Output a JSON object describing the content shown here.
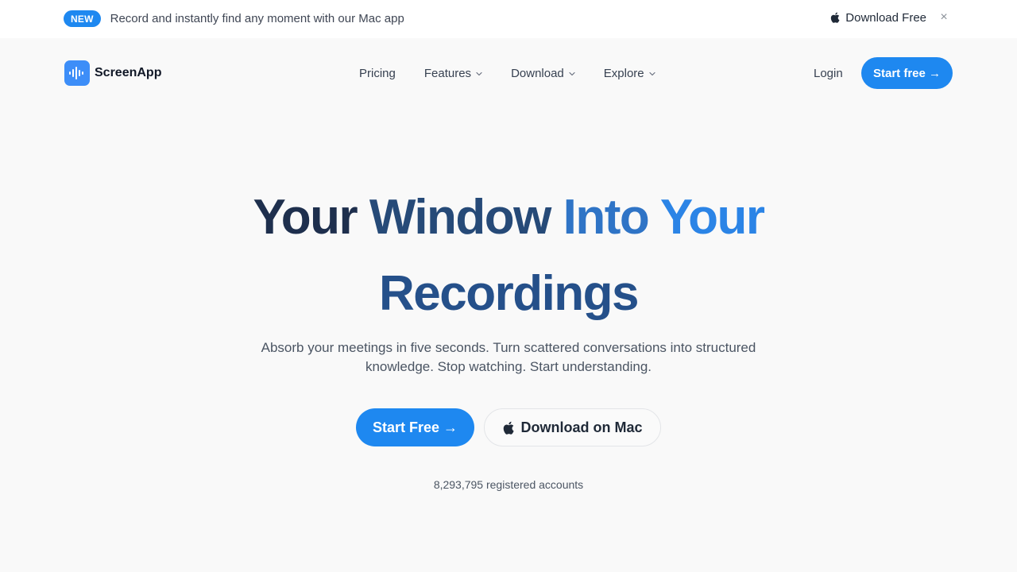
{
  "announcement": {
    "badge": "NEW",
    "text": "Record and instantly find any moment with our Mac app",
    "download_label": "Download Free",
    "close_symbol": "×",
    "apple_icon": "apple-icon"
  },
  "nav": {
    "brand": "ScreenApp",
    "brand_color": "#3d8ef8",
    "items": [
      {
        "label": "Pricing",
        "has_dropdown": false
      },
      {
        "label": "Features",
        "has_dropdown": true
      },
      {
        "label": "Download",
        "has_dropdown": true
      },
      {
        "label": "Explore",
        "has_dropdown": true
      }
    ],
    "login": "Login",
    "start": "Start free →"
  },
  "hero": {
    "title_words": [
      "Your",
      "Window",
      "Into",
      "Your",
      "Recordings"
    ],
    "subtitle": "Absorb your meetings in five seconds. Turn scattered conversations into structured knowledge. Stop watching. Start understanding.",
    "cta_primary": "Start Free →",
    "cta_secondary": "Download on Mac",
    "accounts": "8,293,795 registered accounts"
  },
  "colors": {
    "accent": "#1e88f0",
    "title_dark": "#1e2f4d",
    "title_blue": "#2b84e6",
    "background": "#f9f9f9"
  }
}
